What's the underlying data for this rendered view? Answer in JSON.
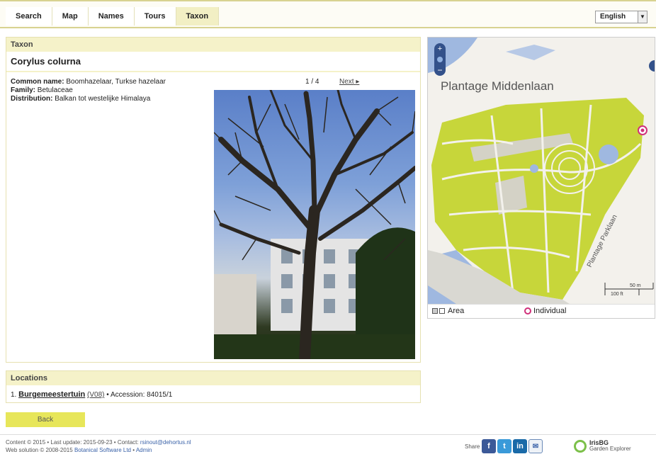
{
  "nav": {
    "tabs": [
      "Search",
      "Map",
      "Names",
      "Tours",
      "Taxon"
    ],
    "active": "Taxon",
    "language": "English"
  },
  "taxon": {
    "panel_title": "Taxon",
    "name": "Corylus colurna",
    "common_label": "Common name:",
    "common_value": "Boomhazelaar, Turkse hazelaar",
    "family_label": "Family:",
    "family_value": "Betulaceae",
    "distribution_label": "Distribution:",
    "distribution_value": "Balkan tot westelijke Himalaya",
    "pager": "1 / 4",
    "next_label": "Next"
  },
  "map": {
    "street_top": "Plantage Middenlaan",
    "street_right": "Plantage Parklaan",
    "scale_m": "50 m",
    "scale_ft": "100 ft",
    "legend_area": "Area",
    "legend_individual": "Individual"
  },
  "locations": {
    "title": "Locations",
    "index": "1.",
    "garden": "Burgemeestertuin",
    "code": "(V08)",
    "accession": "• Accession: 84015/1"
  },
  "back_label": "Back",
  "footer": {
    "line1_prefix": "Content © 2015 • Last update: 2015-09-23 • Contact:",
    "contact": "rsinout@dehortus.nl",
    "line2_prefix": "Web solution © 2008-2015",
    "company": "Botanical Software Ltd",
    "admin": "Admin",
    "share": "Share",
    "brand": "IrisBG",
    "brand_sub": "Garden Explorer"
  },
  "colors": {
    "accent_yellow": "#e7e65a",
    "panel_header": "#f5f2c9",
    "map_green": "#c7d63a",
    "map_water": "#9fb8e0"
  }
}
